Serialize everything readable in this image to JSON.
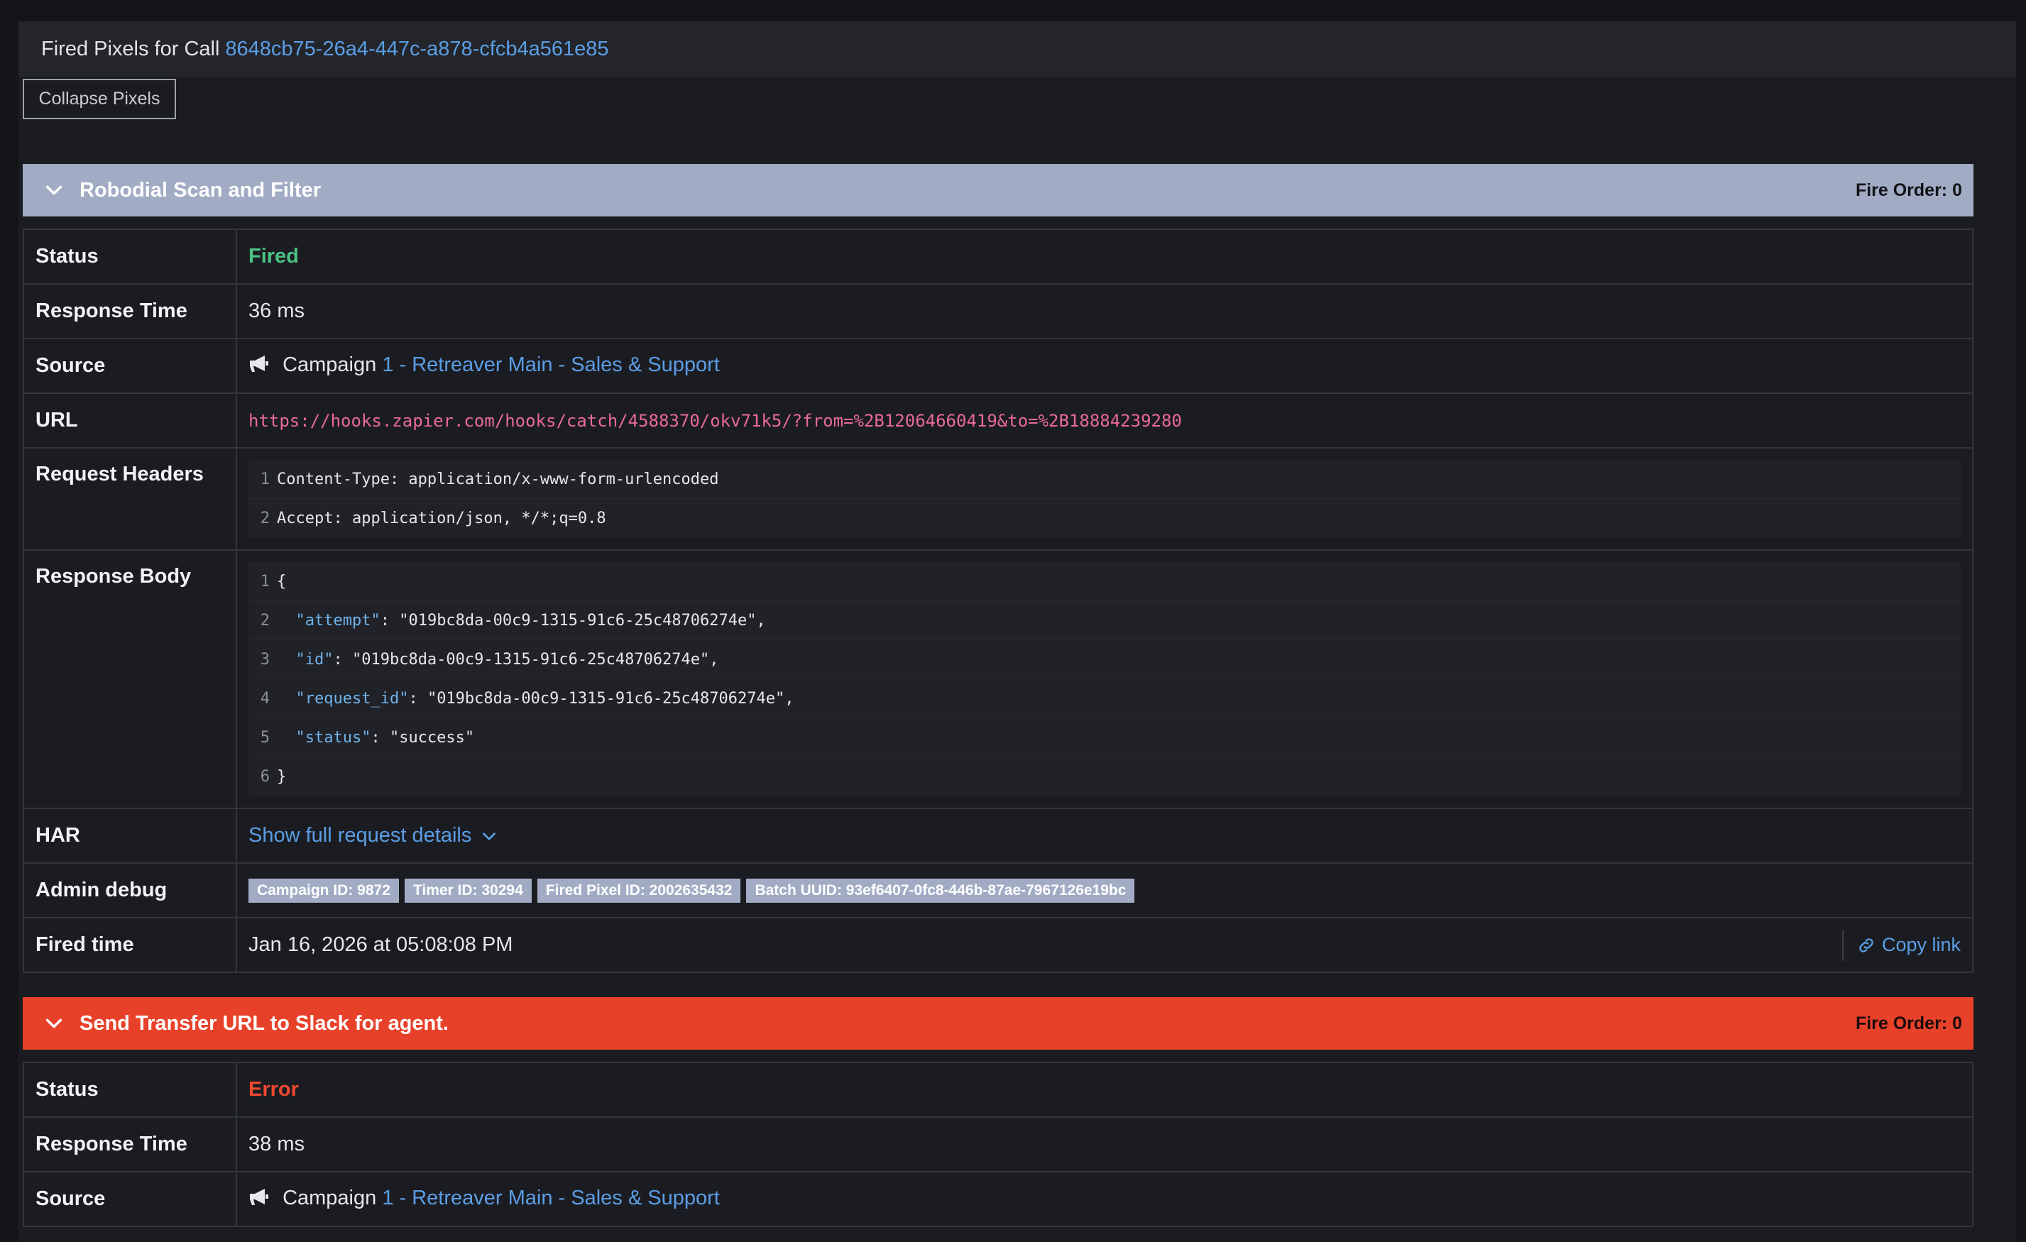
{
  "header": {
    "title_prefix": "Fired Pixels for Call",
    "call_uuid": "8648cb75-26a4-447c-a878-cfcb4a561e85"
  },
  "collapse_button": "Collapse Pixels",
  "labels": {
    "status": "Status",
    "response_time": "Response Time",
    "source": "Source",
    "url": "URL",
    "request_headers": "Request Headers",
    "response_body": "Response Body",
    "har": "HAR",
    "admin_debug": "Admin debug",
    "fired_time": "Fired time"
  },
  "pixels": [
    {
      "title": "Robodial Scan and Filter",
      "fire_order": "Fire Order: 0",
      "bar_color": "#a1abc4",
      "status": "Fired",
      "status_color": "#4cc283",
      "response_time": "36 ms",
      "source_prefix": "Campaign",
      "source_link": "1 - Retreaver Main - Sales & Support",
      "url": "https://hooks.zapier.com/hooks/catch/4588370/okv71k5/?from=%2B12064660419&to=%2B18884239280",
      "request_headers": [
        {
          "n": "1",
          "text": "Content-Type: application/x-www-form-urlencoded"
        },
        {
          "n": "2",
          "text": "Accept: application/json, */*;q=0.8"
        }
      ],
      "response_body": [
        {
          "n": "1",
          "text": "{"
        },
        {
          "n": "2",
          "key": "\"attempt\"",
          "rest": ": \"019bc8da-00c9-1315-91c6-25c48706274e\","
        },
        {
          "n": "3",
          "key": "\"id\"",
          "rest": ": \"019bc8da-00c9-1315-91c6-25c48706274e\","
        },
        {
          "n": "4",
          "key": "\"request_id\"",
          "rest": ": \"019bc8da-00c9-1315-91c6-25c48706274e\","
        },
        {
          "n": "5",
          "key": "\"status\"",
          "rest": ": \"success\""
        },
        {
          "n": "6",
          "text": "}"
        }
      ],
      "har_link": "Show full request details",
      "admin_badges": [
        "Campaign ID: 9872",
        "Timer ID: 30294",
        "Fired Pixel ID: 2002635432",
        "Batch UUID: 93ef6407-0fc8-446b-87ae-7967126e19bc"
      ],
      "fired_time": "Jan 16, 2026 at 05:08:08 PM",
      "copy_link": "Copy link"
    },
    {
      "title": "Send Transfer URL to Slack for agent.",
      "fire_order": "Fire Order: 0",
      "bar_color": "#e8412a",
      "status": "Error",
      "status_color": "#ef4a30",
      "response_time": "38 ms",
      "source_prefix": "Campaign",
      "source_link": "1 - Retreaver Main - Sales & Support"
    }
  ]
}
